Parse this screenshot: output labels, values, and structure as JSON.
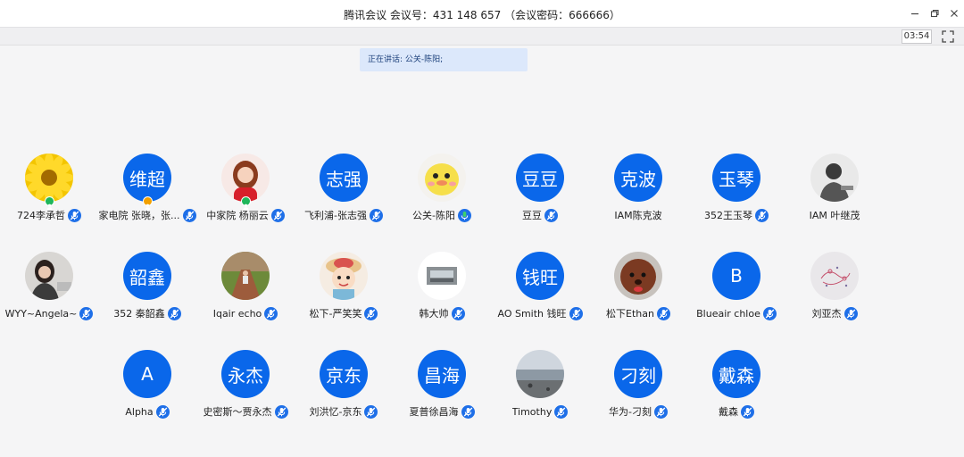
{
  "window": {
    "title": "腾讯会议 会议号：431 148 657 （会议密码：666666）",
    "minimize_icon": "minimize-icon",
    "restore_icon": "restore-icon",
    "close_icon": "close-icon"
  },
  "toolbar": {
    "timer": "03:54",
    "fullscreen_icon": "fullscreen-icon"
  },
  "speaking": {
    "label": "正在讲话: ",
    "name": "公关-陈阳;"
  },
  "colors": {
    "accent": "#0a67ea",
    "host_badge": "#f2a000",
    "cohost_badge": "#1fb65b",
    "mic": "#1e6fe8",
    "speaking_bg": "#dce8fb"
  },
  "participants": [
    {
      "name": "724李承哲",
      "avatar": "photo-sunflower",
      "badge": "cohost",
      "mic": "muted"
    },
    {
      "name": "家电院 张晓，张...",
      "avatar_text": "维超",
      "badge": "host",
      "mic": "muted"
    },
    {
      "name": "中家院 杨丽云",
      "avatar": "photo-girl",
      "badge": "cohost",
      "mic": "muted"
    },
    {
      "name": "飞利浦-张志强",
      "avatar_text": "志强",
      "mic": "muted"
    },
    {
      "name": "公关-陈阳",
      "avatar": "photo-duck",
      "mic": "speaking"
    },
    {
      "name": "豆豆",
      "avatar_text": "豆豆",
      "mic": "muted"
    },
    {
      "name": "IAM陈克波",
      "avatar_text": "克波",
      "mic": "none"
    },
    {
      "name": "352王玉琴",
      "avatar_text": "玉琴",
      "mic": "muted"
    },
    {
      "name": "IAM 叶继茂",
      "avatar": "photo-man",
      "mic": "none"
    },
    {
      "name": "WYY~Angela~",
      "avatar": "photo-woman",
      "mic": "muted"
    },
    {
      "name": "352 秦韶鑫",
      "avatar_text": "韶鑫",
      "mic": "muted"
    },
    {
      "name": "Iqair echo",
      "avatar": "photo-garden",
      "mic": "muted"
    },
    {
      "name": "松下-严笑笑",
      "avatar": "photo-cartoon-girl",
      "mic": "muted"
    },
    {
      "name": "韩大帅",
      "avatar": "photo-room",
      "mic": "muted"
    },
    {
      "name": "AO Smith  钱旺",
      "avatar_text": "钱旺",
      "mic": "muted"
    },
    {
      "name": "松下Ethan",
      "avatar": "photo-dog",
      "mic": "muted"
    },
    {
      "name": "Blueair chloe",
      "avatar_text": "B",
      "mic": "muted"
    },
    {
      "name": "刘亚杰",
      "avatar": "photo-sketch",
      "mic": "muted"
    },
    {
      "name": "Alpha",
      "avatar_text": "A",
      "mic": "muted"
    },
    {
      "name": "史密斯～贾永杰",
      "avatar_text": "永杰",
      "mic": "muted"
    },
    {
      "name": "刘洪忆-京东",
      "avatar_text": "京东",
      "mic": "muted"
    },
    {
      "name": "夏普徐昌海",
      "avatar_text": "昌海",
      "mic": "muted"
    },
    {
      "name": "Timothy",
      "avatar": "photo-lake",
      "mic": "muted"
    },
    {
      "name": "华为-刁刻",
      "avatar_text": "刁刻",
      "mic": "muted"
    },
    {
      "name": "戴森",
      "avatar_text": "戴森",
      "mic": "muted"
    }
  ]
}
